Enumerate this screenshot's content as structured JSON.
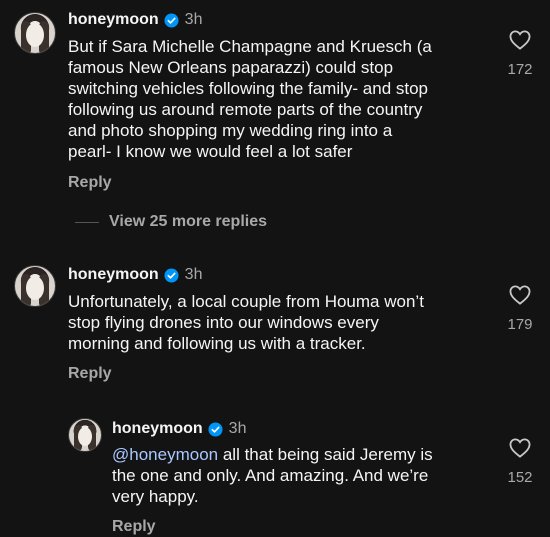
{
  "comments": [
    {
      "username": "honeymoon",
      "time": "3h",
      "text": [
        "But if Sara Michelle Champagne and Kruesch (a",
        "famous New Orleans paparazzi) could stop",
        "switching vehicles following the family- and  stop",
        "following us around remote parts of the country",
        "and photo shopping my wedding ring into a",
        "pearl- I know we would feel a lot safer"
      ],
      "reply_label": "Reply",
      "likes": "172"
    },
    {
      "username": "honeymoon",
      "time": "3h",
      "text": [
        "Unfortunately, a local couple from Houma won’t",
        "stop flying drones into our windows every",
        "morning and following us with a tracker."
      ],
      "reply_label": "Reply",
      "likes": "179"
    },
    {
      "username": "honeymoon",
      "time": "3h",
      "mention": "@honeymoon",
      "text": [
        " all that being said Jeremy is",
        "the one and only. And amazing. And we’re",
        "very happy."
      ],
      "reply_label": "Reply",
      "likes": "152"
    }
  ],
  "view_more_replies": "View 25 more replies",
  "colors": {
    "background": "#131313",
    "verified": "#0095f6",
    "muted": "#a8a8a8",
    "mention": "#a9c7ff"
  },
  "icons": {
    "like": "heart-outline-icon",
    "verified": "verified-badge-icon"
  }
}
